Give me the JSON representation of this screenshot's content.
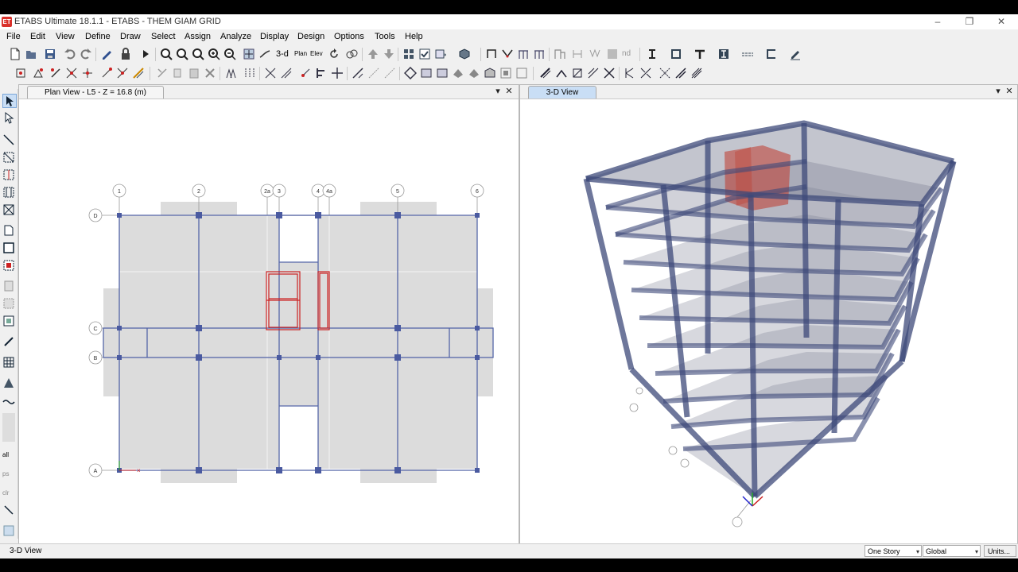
{
  "app": {
    "logo": "ET",
    "title": "ETABS Ultimate 18.1.1 - ETABS - THEM GIAM GRID"
  },
  "menu": [
    "File",
    "Edit",
    "View",
    "Define",
    "Draw",
    "Select",
    "Assign",
    "Analyze",
    "Display",
    "Design",
    "Options",
    "Tools",
    "Help"
  ],
  "toolbar_text": {
    "view_3d": "3-d",
    "plan": "Plan",
    "elev": "Elev",
    "nd": "nd"
  },
  "left_toolbar_text": {
    "all": "all",
    "ps": "ps",
    "clr": "clr"
  },
  "plan_view": {
    "tab_label": "Plan View - L5 - Z = 16.8 (m)",
    "grid_columns": [
      "1",
      "2",
      "2a",
      "3",
      "4",
      "4a",
      "5",
      "6"
    ],
    "grid_rows": [
      "D",
      "C",
      "B",
      "A"
    ]
  },
  "view_3d": {
    "tab_label": "3-D View"
  },
  "status": {
    "left_text": "3-D View",
    "story_option": "One Story",
    "coord_option": "Global",
    "units_label": "Units..."
  },
  "colors": {
    "frame": "#5566a8",
    "slab": "#dcdcdc",
    "selected_wall": "#cc2222",
    "active_tab": "#c9def5"
  }
}
